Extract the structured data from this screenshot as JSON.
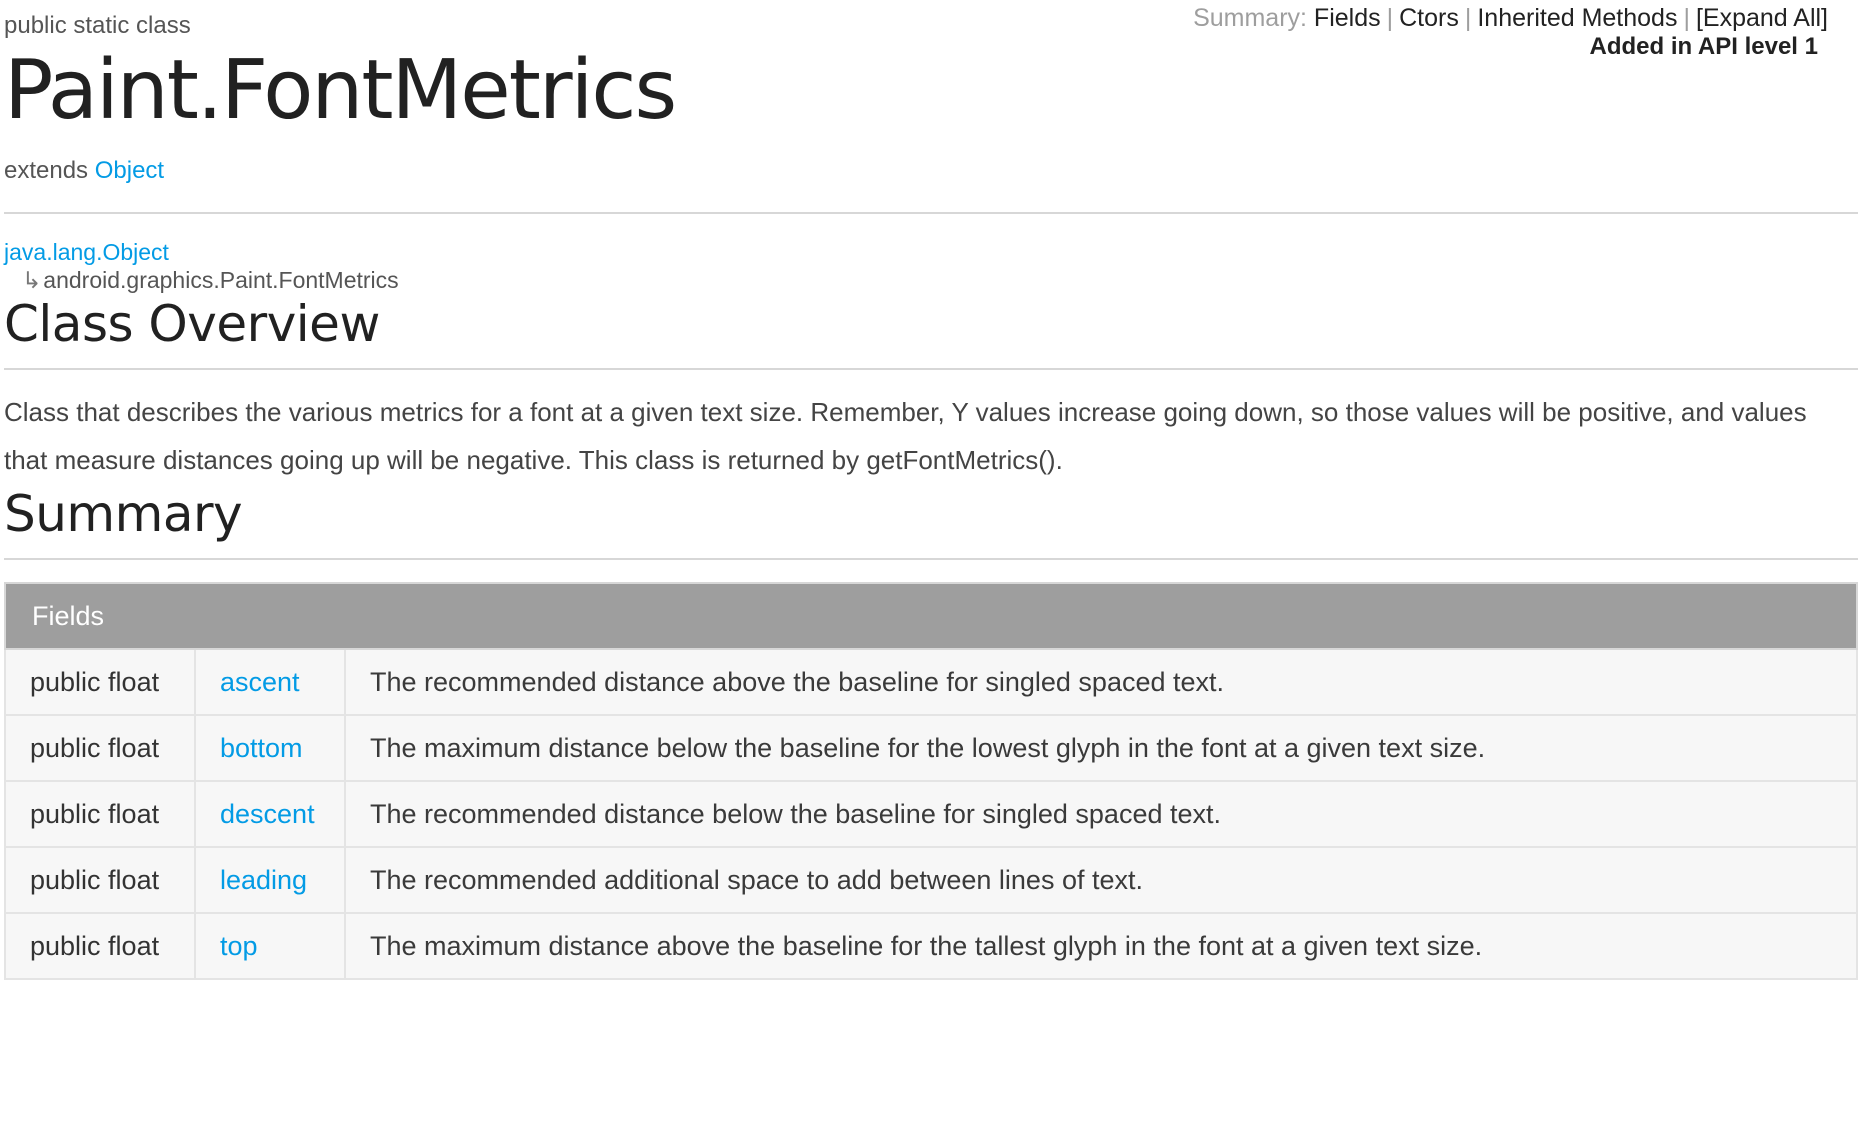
{
  "summary_nav": {
    "label": "Summary:",
    "links": [
      "Fields",
      "Ctors",
      "Inherited Methods",
      "[Expand All]"
    ],
    "api_level": "Added in API level 1"
  },
  "class_info": {
    "modifiers": "public static class",
    "title": "Paint.FontMetrics",
    "extends_label": "extends",
    "extends_link": "Object"
  },
  "hierarchy": {
    "parent": "java.lang.Object",
    "arrow": "↳",
    "child": "android.graphics.Paint.FontMetrics"
  },
  "overview": {
    "heading": "Class Overview",
    "text": "Class that describes the various metrics for a font at a given text size. Remember, Y values increase going down, so those values will be positive, and values that measure distances going up will be negative. This class is returned by getFontMetrics()."
  },
  "summary": {
    "heading": "Summary",
    "table_header": "Fields",
    "fields": [
      {
        "type": "public float",
        "name": "ascent",
        "description": "The recommended distance above the baseline for singled spaced text."
      },
      {
        "type": "public float",
        "name": "bottom",
        "description": "The maximum distance below the baseline for the lowest glyph in the font at a given text size."
      },
      {
        "type": "public float",
        "name": "descent",
        "description": "The recommended distance below the baseline for singled spaced text."
      },
      {
        "type": "public float",
        "name": "leading",
        "description": "The recommended additional space to add between lines of text."
      },
      {
        "type": "public float",
        "name": "top",
        "description": "The maximum distance above the baseline for the tallest glyph in the font at a given text size."
      }
    ]
  },
  "colors": {
    "link": "#039be5",
    "table_header_bg": "#9e9e9e",
    "row_bg": "#f7f7f7"
  }
}
